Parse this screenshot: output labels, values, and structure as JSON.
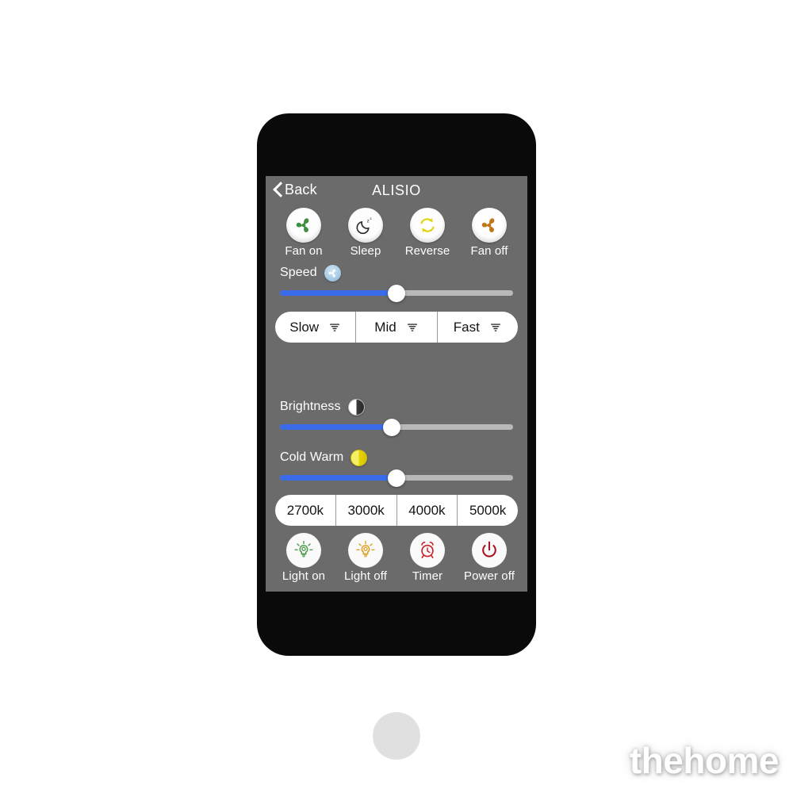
{
  "app": {
    "back_label": "Back",
    "title": "ALISIO"
  },
  "fan_controls": [
    {
      "label": "Fan on",
      "icon": "fan-icon",
      "color": "#3f8f3f"
    },
    {
      "label": "Sleep",
      "icon": "moon-zzz-icon",
      "color": "#2b2b2b"
    },
    {
      "label": "Reverse",
      "icon": "refresh-loop-icon",
      "color": "#e0d515"
    },
    {
      "label": "Fan off",
      "icon": "fan-icon",
      "color": "#c0761a"
    }
  ],
  "speed": {
    "label": "Speed",
    "badge_icon": "fan-badge-icon",
    "slider_value": 50,
    "fill_color": "#3a6bea",
    "track_color": "#b9b9b9"
  },
  "speed_presets": [
    {
      "label": "Slow",
      "icon": "tornado-icon"
    },
    {
      "label": "Mid",
      "icon": "tornado-icon"
    },
    {
      "label": "Fast",
      "icon": "tornado-icon"
    }
  ],
  "brightness": {
    "label": "Brightness",
    "badge_icon": "half-circle-contrast-icon",
    "slider_value": 48
  },
  "cold_warm": {
    "label": "Cold Warm",
    "badge_icon": "half-circle-yellow-icon",
    "slider_value": 50
  },
  "color_temps": [
    {
      "label": "2700k"
    },
    {
      "label": "3000k"
    },
    {
      "label": "4000k"
    },
    {
      "label": "5000k"
    }
  ],
  "light_controls": [
    {
      "label": "Light on",
      "icon": "bulb-on-icon",
      "color": "#4a9a4a"
    },
    {
      "label": "Light off",
      "icon": "bulb-off-icon",
      "color": "#dd9e22"
    },
    {
      "label": "Timer",
      "icon": "alarm-clock-icon",
      "color": "#cc1f2a"
    },
    {
      "label": "Power off",
      "icon": "power-icon",
      "color": "#a81420"
    }
  ],
  "watermark": {
    "text": "thehome"
  }
}
